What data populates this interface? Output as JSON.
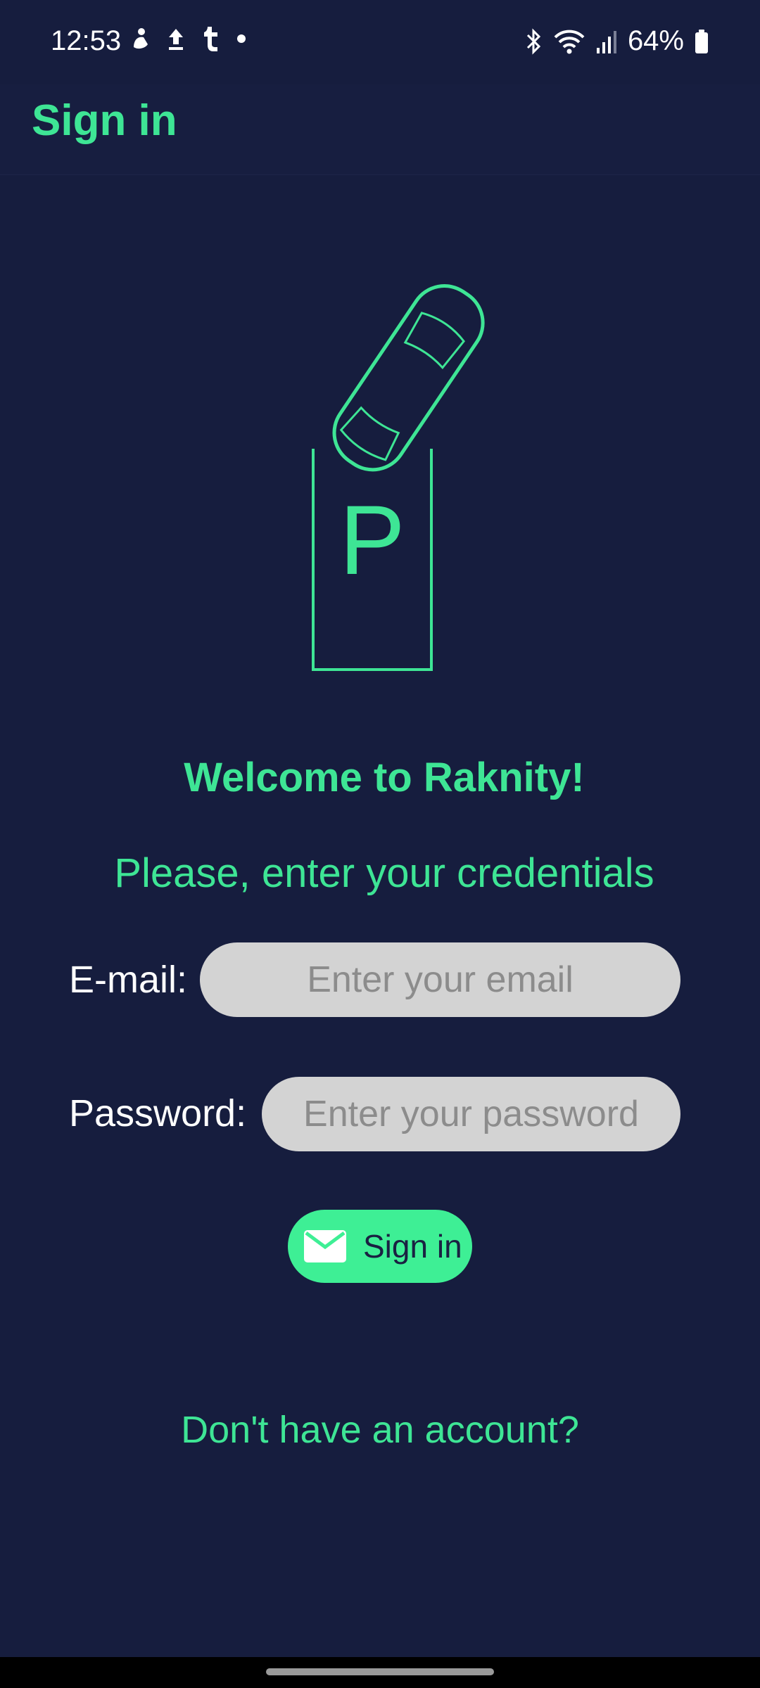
{
  "status_bar": {
    "time": "12:53",
    "battery": "64%",
    "left_icons": [
      "notification-icon",
      "upload-icon",
      "tumblr-icon",
      "dot-icon"
    ],
    "right_icons": [
      "bluetooth-icon",
      "wifi-icon",
      "signal-icon",
      "battery-icon"
    ]
  },
  "appbar": {
    "title": "Sign in"
  },
  "hero": {
    "logo_letter": "P"
  },
  "welcome": "Welcome to Raknity!",
  "subtitle": "Please, enter your credentials",
  "form": {
    "email_label": "E-mail:",
    "email_placeholder": "Enter your email",
    "email_value": "",
    "password_label": "Password:",
    "password_placeholder": "Enter your password",
    "password_value": ""
  },
  "signin_button": {
    "label": "Sign in",
    "icon": "envelope-icon"
  },
  "signup_link": "Don't have an account?",
  "colors": {
    "background": "#161d3e",
    "accent": "#3ee595",
    "button": "#3eef95",
    "input": "#d3d3d3"
  }
}
